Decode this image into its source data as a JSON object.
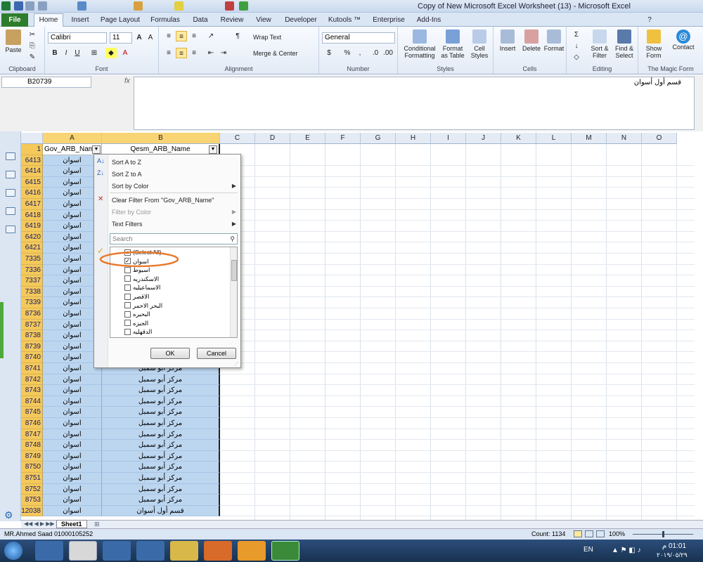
{
  "window": {
    "title": "Copy of New Microsoft Excel Worksheet (13) - Microsoft Excel"
  },
  "tabs": [
    "File",
    "Home",
    "Insert",
    "Page Layout",
    "Formulas",
    "Data",
    "Review",
    "View",
    "Developer",
    "Kutools ™",
    "Enterprise",
    "Add-Ins"
  ],
  "ribbon": {
    "paste": "Paste",
    "font_name": "Calibri",
    "font_size": "11",
    "wrap_text": "Wrap Text",
    "merge_center": "Merge & Center",
    "number_format": "General",
    "conditional": "Conditional Formatting",
    "format_table": "Format as Table",
    "cell_styles": "Cell Styles",
    "insert": "Insert",
    "delete": "Delete",
    "format": "Format",
    "sort_filter": "Sort & Filter",
    "find_select": "Find & Select",
    "show_form": "Show Form",
    "contact": "Contact",
    "groups": {
      "clipboard": "Clipboard",
      "font": "Font",
      "alignment": "Alignment",
      "number": "Number",
      "styles": "Styles",
      "cells": "Cells",
      "editing": "Editing",
      "magic": "The Magic Form"
    }
  },
  "formula_bar": {
    "name_box": "B20739",
    "fx": "fx",
    "value": "قسم أول أسوان"
  },
  "columns": [
    "A",
    "B",
    "C",
    "D",
    "E",
    "F",
    "G",
    "H",
    "I",
    "J",
    "K",
    "L",
    "M",
    "N",
    "O"
  ],
  "header_row": {
    "num": "1",
    "a": "Gov_ARB_Nam",
    "b": "Qesm_ARB_Name"
  },
  "rows": [
    {
      "num": "6413",
      "a": "اسوان",
      "b": ""
    },
    {
      "num": "6414",
      "a": "اسوان",
      "b": ""
    },
    {
      "num": "6415",
      "a": "اسوان",
      "b": ""
    },
    {
      "num": "6416",
      "a": "اسوان",
      "b": ""
    },
    {
      "num": "6417",
      "a": "اسوان",
      "b": ""
    },
    {
      "num": "6418",
      "a": "اسوان",
      "b": ""
    },
    {
      "num": "6419",
      "a": "اسوان",
      "b": ""
    },
    {
      "num": "6420",
      "a": "اسوان",
      "b": ""
    },
    {
      "num": "6421",
      "a": "اسوان",
      "b": ""
    },
    {
      "num": "7335",
      "a": "اسوان",
      "b": ""
    },
    {
      "num": "7336",
      "a": "اسوان",
      "b": ""
    },
    {
      "num": "7337",
      "a": "اسوان",
      "b": ""
    },
    {
      "num": "7338",
      "a": "اسوان",
      "b": ""
    },
    {
      "num": "7339",
      "a": "اسوان",
      "b": ""
    },
    {
      "num": "8736",
      "a": "اسوان",
      "b": ""
    },
    {
      "num": "8737",
      "a": "اسوان",
      "b": ""
    },
    {
      "num": "8738",
      "a": "اسوان",
      "b": ""
    },
    {
      "num": "8739",
      "a": "اسوان",
      "b": ""
    },
    {
      "num": "8740",
      "a": "اسوان",
      "b": ""
    },
    {
      "num": "8741",
      "a": "اسوان",
      "b": "مركز أبو سمبل"
    },
    {
      "num": "8742",
      "a": "اسوان",
      "b": "مركز أبو سمبل"
    },
    {
      "num": "8743",
      "a": "اسوان",
      "b": "مركز أبو سمبل"
    },
    {
      "num": "8744",
      "a": "اسوان",
      "b": "مركز أبو سمبل"
    },
    {
      "num": "8745",
      "a": "اسوان",
      "b": "مركز أبو سمبل"
    },
    {
      "num": "8746",
      "a": "اسوان",
      "b": "مركز أبو سمبل"
    },
    {
      "num": "8747",
      "a": "اسوان",
      "b": "مركز أبو سمبل"
    },
    {
      "num": "8748",
      "a": "اسوان",
      "b": "مركز أبو سمبل"
    },
    {
      "num": "8749",
      "a": "اسوان",
      "b": "مركز أبو سمبل"
    },
    {
      "num": "8750",
      "a": "اسوان",
      "b": "مركز أبو سمبل"
    },
    {
      "num": "8751",
      "a": "اسوان",
      "b": "مركز أبو سمبل"
    },
    {
      "num": "8752",
      "a": "اسوان",
      "b": "مركز أبو سمبل"
    },
    {
      "num": "8753",
      "a": "اسوان",
      "b": "مركز أبو سمبل"
    },
    {
      "num": "12038",
      "a": "اسوان",
      "b": "قسم أول أسوان"
    }
  ],
  "filter_menu": {
    "sort_az": "Sort A to Z",
    "sort_za": "Sort Z to A",
    "sort_color": "Sort by Color",
    "clear_filter": "Clear Filter From \"Gov_ARB_Name\"",
    "filter_color": "Filter by Color",
    "text_filters": "Text Filters",
    "search_placeholder": "Search",
    "items": [
      {
        "label": "(Select All)",
        "checked": "partial"
      },
      {
        "label": "اسوان",
        "checked": "checked"
      },
      {
        "label": "اسيوط",
        "checked": "unchecked"
      },
      {
        "label": "الاسكندريه",
        "checked": "unchecked"
      },
      {
        "label": "الاسماعيليه",
        "checked": "unchecked"
      },
      {
        "label": "الاقصر",
        "checked": "unchecked"
      },
      {
        "label": "البحر الاحمر",
        "checked": "unchecked"
      },
      {
        "label": "البحيره",
        "checked": "unchecked"
      },
      {
        "label": "الجيزه",
        "checked": "unchecked"
      },
      {
        "label": "الدقهليه",
        "checked": "unchecked"
      }
    ],
    "ok": "OK",
    "cancel": "Cancel"
  },
  "sheet_tab": "Sheet1",
  "status": {
    "left": "MR.Ahmed Saad 01000105252",
    "count": "Count: 1134",
    "zoom": "100%"
  },
  "taskbar": {
    "lang": "EN",
    "time": "01:01 م",
    "date": "٢٠١٩/٠٥/٢٩"
  },
  "colors": {
    "accent_green": "#2d7d2d",
    "selection_blue": "#bcd6f0",
    "row_header_orange": "#f4c95a",
    "annotation_orange": "#e87a2a"
  }
}
